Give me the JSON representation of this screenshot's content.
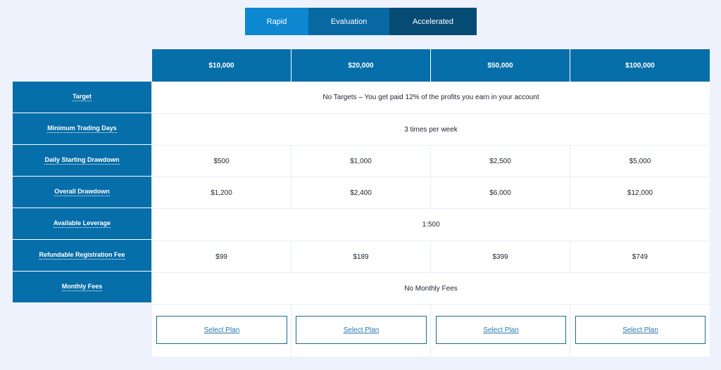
{
  "tabs": [
    "Rapid",
    "Evaluation",
    "Accelerated"
  ],
  "columns": [
    "$10,000",
    "$20,000",
    "$50,000",
    "$100,000"
  ],
  "rows": [
    {
      "label": "Target",
      "merged": "No Targets – You get paid 12% of the profits you earn in your account"
    },
    {
      "label": "Minimum Trading Days",
      "merged": "3 times per week"
    },
    {
      "label": "Daily Starting Drawdown",
      "values": [
        "$500",
        "$1,000",
        "$2,500",
        "$5,000"
      ]
    },
    {
      "label": "Overall Drawdown",
      "values": [
        "$1,200",
        "$2,400",
        "$6,000",
        "$12,000"
      ]
    },
    {
      "label": "Available Leverage",
      "merged": "1:500"
    },
    {
      "label": "Refundable Registration Fee",
      "values": [
        "$99",
        "$189",
        "$399",
        "$749"
      ]
    },
    {
      "label": "Monthly Fees",
      "merged": "No Monthly Fees"
    }
  ],
  "select_label": "Select Plan",
  "colors": {
    "header": "#066ea8",
    "tab_active": "#0d87cf",
    "tab_mid": "#0868a2",
    "tab_dark": "#064b74",
    "background": "#edf2fc"
  }
}
